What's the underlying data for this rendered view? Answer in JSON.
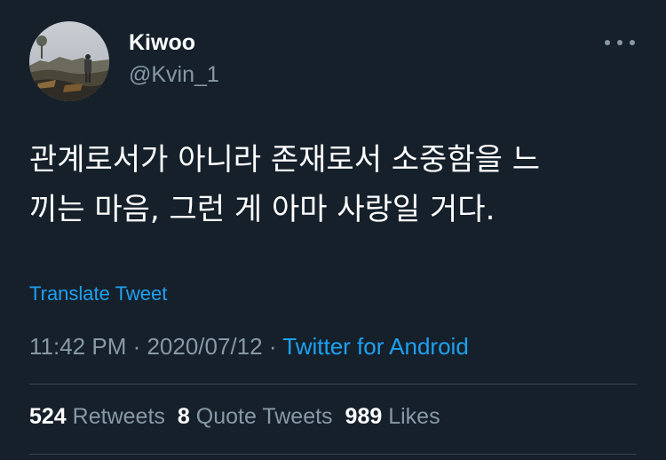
{
  "author": {
    "display_name": "Kiwoo",
    "handle": "@Kvin_1",
    "avatar_icon": "profile-photo"
  },
  "more_icon": "ellipsis-icon",
  "tweet": {
    "text_line1": "관계로서가 아니라 존재로서 소중함을 느",
    "text_line2": "끼는 마음, 그런 게 아마 사랑일 거다."
  },
  "translate_label": "Translate Tweet",
  "meta": {
    "time": "11:42 PM",
    "sep1": " · ",
    "date": "2020/07/12",
    "sep2": " · ",
    "source": "Twitter for Android"
  },
  "stats": {
    "retweets_count": "524",
    "retweets_label": "Retweets",
    "quotes_count": "8",
    "quotes_label": "Quote Tweets",
    "likes_count": "989",
    "likes_label": "Likes"
  },
  "colors": {
    "background": "#15202b",
    "accent": "#1da1f2",
    "secondary_text": "#8899a6",
    "divider": "#38444d"
  }
}
